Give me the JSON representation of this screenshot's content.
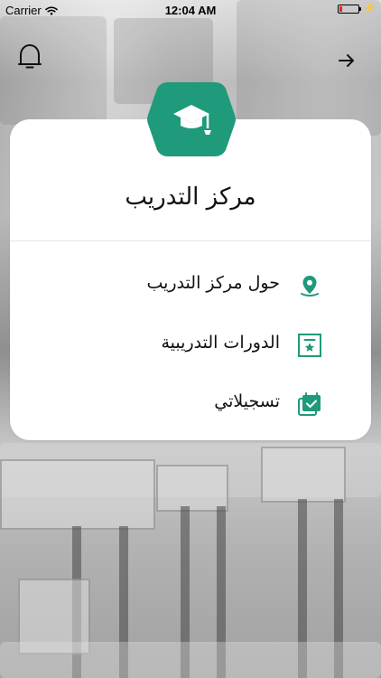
{
  "status_bar": {
    "carrier": "Carrier",
    "time": "12:04 AM",
    "battery_color": "#e22222"
  },
  "header": {
    "left_icon": "bell-icon",
    "right_icon": "arrow-right-icon"
  },
  "card": {
    "title": "مركز التدريب",
    "badge_icon": "graduation-cap-icon",
    "accent_color": "#1f9a7a",
    "items": [
      {
        "label": "حول مركز التدريب",
        "icon": "map-pin-icon"
      },
      {
        "label": "الدورات التدريبية",
        "icon": "bookmark-star-icon"
      },
      {
        "label": "تسجيلاتي",
        "icon": "calendar-check-icon"
      }
    ]
  }
}
